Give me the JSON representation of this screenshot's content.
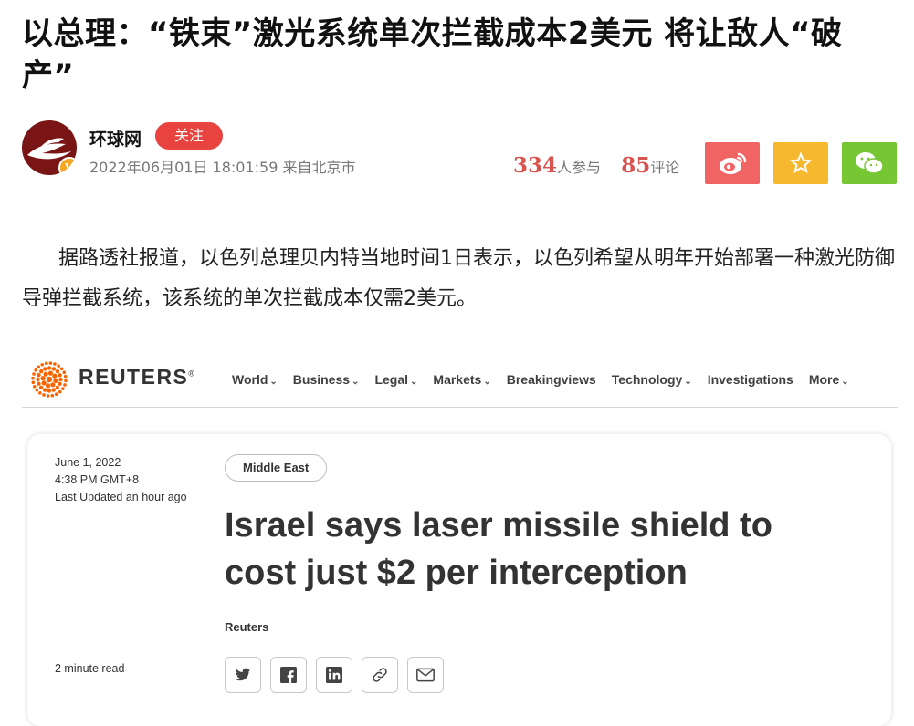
{
  "article": {
    "headline": "以总理：“铁束”激光系统单次拦截成本2美元 将让敌人“破产”",
    "body_paragraph": "据路透社报道，以色列总理贝内特当地时间1日表示，以色列希望从明年开始部署一种激光防御导弹拦截系统，该系统的单次拦截成本仅需2美元。"
  },
  "author": {
    "source_name": "环球网",
    "follow_label": "关注",
    "verified_badge": "V",
    "timestamp": "2022年06月01日 18:01:59 来自北京市"
  },
  "stats": {
    "participants": "334",
    "participants_label": "人参与",
    "comments": "85",
    "comments_label": "评论"
  },
  "share": {
    "icons": [
      "weibo-icon",
      "star-icon",
      "wechat-icon"
    ],
    "colors": {
      "weibo": "#f06464",
      "favorite": "#f5b82e",
      "wechat": "#77c634"
    }
  },
  "reuters": {
    "wordmark": "REUTERS",
    "trademark": "®",
    "nav": [
      {
        "label": "World",
        "dropdown": true
      },
      {
        "label": "Business",
        "dropdown": true
      },
      {
        "label": "Legal",
        "dropdown": true
      },
      {
        "label": "Markets",
        "dropdown": true
      },
      {
        "label": "Breakingviews",
        "dropdown": false
      },
      {
        "label": "Technology",
        "dropdown": true
      },
      {
        "label": "Investigations",
        "dropdown": false
      },
      {
        "label": "More",
        "dropdown": true
      }
    ],
    "date": "June 1, 2022",
    "time": "4:38 PM GMT+8",
    "updated": "Last Updated an hour ago",
    "tag": "Middle East",
    "headline": "Israel says laser missile shield to cost just $2 per interception",
    "byline": "Reuters",
    "read_time": "2 minute read",
    "social": [
      "twitter-icon",
      "facebook-icon",
      "linkedin-icon",
      "link-icon",
      "email-icon"
    ],
    "accent": "#fa6400"
  }
}
